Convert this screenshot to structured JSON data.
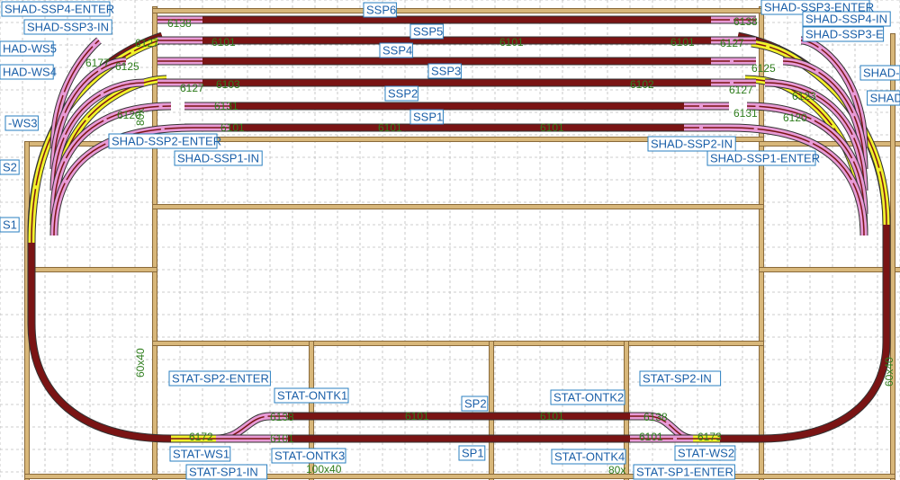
{
  "colors": {
    "board": "#d8b77a",
    "board_edge": "#8a6a3a",
    "grid": "#bcbcbc",
    "rail_dark": "#7a1414",
    "rail_pink": "#e89ad6",
    "rail_yellow": "#f2f22a",
    "rail_edge": "#333333",
    "label_text": "#1a5fa8",
    "label_border": "#2a7fc0",
    "number_text": "#2e7d1c"
  },
  "labels": [
    "SHAD-SSP4-ENTER",
    "SHAD-SSP3-IN",
    "HAD-WS5",
    "HAD-WS4",
    "-WS3",
    "S2",
    "S1",
    "SSP6",
    "SSP5",
    "SSP4",
    "SSP3",
    "SSP2",
    "SSP1",
    "SHAD-SSP2-ENTER",
    "SHAD-SSP1-IN",
    "SHAD-SSP3-ENTER",
    "SHAD-SSP4-IN",
    "SHAD-SSP3-E",
    "SHAD-",
    "SHAD",
    "SHAD-SSP2-IN",
    "SHAD-SSP1-ENTER",
    "STAT-SP2-ENTER",
    "STAT-ONTK1",
    "STAT-WS1",
    "STAT-SP1-IN",
    "STAT-ONTK3",
    "SP2",
    "SP1",
    "STAT-ONTK2",
    "STAT-ONTK4",
    "STAT-SP2-IN",
    "STAT-WS2",
    "STAT-SP1-ENTER"
  ],
  "track_numbers": [
    "6138",
    "6127",
    "6125",
    "6177",
    "6131",
    "6120",
    "6101",
    "6103",
    "6102",
    "6172",
    "6173",
    "6126",
    "6123",
    "6171"
  ],
  "dimensions": [
    "60x40",
    "60x40",
    "100x40",
    "80x",
    "80x"
  ]
}
